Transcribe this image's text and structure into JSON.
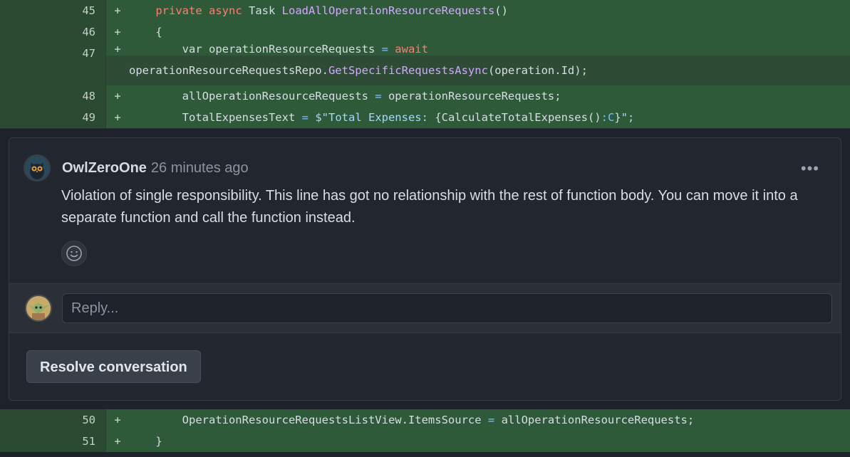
{
  "diff_top": [
    {
      "line": "45",
      "sign": "+",
      "segments": [
        {
          "t": "    ",
          "c": ""
        },
        {
          "t": "private",
          "c": "kw"
        },
        {
          "t": " ",
          "c": ""
        },
        {
          "t": "async",
          "c": "kw"
        },
        {
          "t": " Task ",
          "c": ""
        },
        {
          "t": "LoadAllOperationResourceRequests",
          "c": "fn"
        },
        {
          "t": "()",
          "c": ""
        }
      ]
    },
    {
      "line": "46",
      "sign": "+",
      "segments": [
        {
          "t": "    {",
          "c": ""
        }
      ]
    },
    {
      "line": "47",
      "sign": "+",
      "segments": [
        {
          "t": "        var operationResourceRequests ",
          "c": ""
        },
        {
          "t": "=",
          "c": "op"
        },
        {
          "t": " ",
          "c": ""
        },
        {
          "t": "await",
          "c": "kw"
        }
      ],
      "wrap": [
        {
          "t": "operationResourceRequestsRepo.",
          "c": ""
        },
        {
          "t": "GetSpecificRequestsAsync",
          "c": "fn"
        },
        {
          "t": "(operation.Id);",
          "c": ""
        }
      ]
    },
    {
      "line": "48",
      "sign": "+",
      "segments": [
        {
          "t": "        allOperationResourceRequests ",
          "c": ""
        },
        {
          "t": "=",
          "c": "op"
        },
        {
          "t": " operationResourceRequests;",
          "c": ""
        }
      ]
    },
    {
      "line": "49",
      "sign": "+",
      "segments": [
        {
          "t": "        TotalExpensesText ",
          "c": ""
        },
        {
          "t": "=",
          "c": "op"
        },
        {
          "t": " ",
          "c": ""
        },
        {
          "t": "$\"Total Expenses: ",
          "c": "str"
        },
        {
          "t": "{CalculateTotalExpenses()",
          "c": ""
        },
        {
          "t": ":C",
          "c": "op"
        },
        {
          "t": "}",
          "c": ""
        },
        {
          "t": "\";",
          "c": "str"
        }
      ]
    }
  ],
  "diff_bottom": [
    {
      "line": "50",
      "sign": "+",
      "segments": [
        {
          "t": "        OperationResourceRequestsListView.ItemsSource ",
          "c": ""
        },
        {
          "t": "=",
          "c": "op"
        },
        {
          "t": " allOperationResourceRequests;",
          "c": ""
        }
      ]
    },
    {
      "line": "51",
      "sign": "+",
      "segments": [
        {
          "t": "    }",
          "c": ""
        }
      ]
    }
  ],
  "comment": {
    "author": "OwlZeroOne",
    "time": "26 minutes ago",
    "menu_glyph": "•••",
    "body": "Violation of single responsibility. This line has got no relationship with the rest of function body. You can move it into a separate function and call the function instead."
  },
  "reply": {
    "placeholder": "Reply..."
  },
  "resolve_label": "Resolve conversation",
  "icons": {
    "menu": "kebab-icon",
    "reaction": "smiley-icon",
    "avatar_author": "owl-avatar",
    "avatar_user": "yoda-avatar"
  }
}
